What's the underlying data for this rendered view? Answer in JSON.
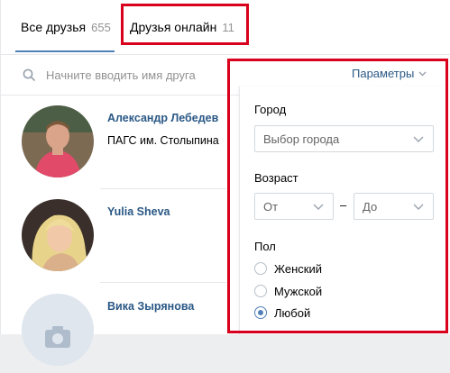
{
  "tabs": [
    {
      "label": "Все друзья",
      "count": "655"
    },
    {
      "label": "Друзья онлайн",
      "count": "11"
    }
  ],
  "search": {
    "placeholder": "Начните вводить имя друга"
  },
  "params_label": "Параметры",
  "friends": [
    {
      "name": "Александр Лебедев",
      "sub": "ПАГС им. Столыпина"
    },
    {
      "name": "Yulia Sheva",
      "sub": ""
    },
    {
      "name": "Вика Зырянова",
      "sub": ""
    }
  ],
  "filter": {
    "city_label": "Город",
    "city_value": "Выбор города",
    "age_label": "Возраст",
    "age_from": "От",
    "age_dash": "–",
    "age_to": "До",
    "sex_label": "Пол",
    "sex_options": [
      {
        "label": "Женский",
        "checked": false
      },
      {
        "label": "Мужской",
        "checked": false
      },
      {
        "label": "Любой",
        "checked": true
      }
    ]
  },
  "colors": {
    "accent": "#5181b8",
    "link": "#2a5885",
    "highlight": "#d8001c"
  }
}
